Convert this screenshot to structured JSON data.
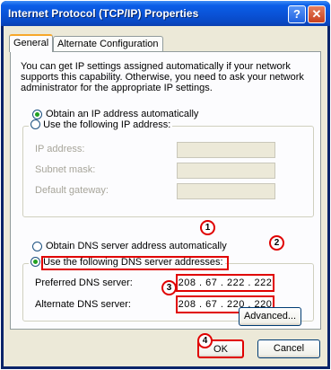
{
  "window": {
    "title": "Internet Protocol (TCP/IP) Properties",
    "help_label": "?",
    "close_label": "✕"
  },
  "tabs": [
    {
      "label": "General",
      "active": true
    },
    {
      "label": "Alternate Configuration",
      "active": false
    }
  ],
  "general": {
    "description": "You can get IP settings assigned automatically if your network supports this capability. Otherwise, you need to ask your network administrator for the appropriate IP settings.",
    "ip": {
      "auto_label": "Obtain an IP address automatically",
      "manual_label": "Use the following IP address:",
      "selected": "auto",
      "fields": [
        {
          "label": "IP address:",
          "value": ""
        },
        {
          "label": "Subnet mask:",
          "value": ""
        },
        {
          "label": "Default gateway:",
          "value": ""
        }
      ]
    },
    "dns": {
      "auto_label": "Obtain DNS server address automatically",
      "manual_label": "Use the following DNS server addresses:",
      "selected": "manual",
      "preferred_label": "Preferred DNS server:",
      "preferred_value": "208 .  67 . 222 . 222",
      "alternate_label": "Alternate DNS server:",
      "alternate_value": "208 .  67 . 220 . 220"
    },
    "advanced_label": "Advanced..."
  },
  "footer": {
    "ok_label": "OK",
    "cancel_label": "Cancel"
  },
  "callouts": [
    "1",
    "2",
    "3",
    "4"
  ],
  "colors": {
    "highlight": "#e00000",
    "titlebar": "#0a52d6",
    "dialog_bg": "#ece9d8",
    "tab_accent": "#f7a82b"
  }
}
